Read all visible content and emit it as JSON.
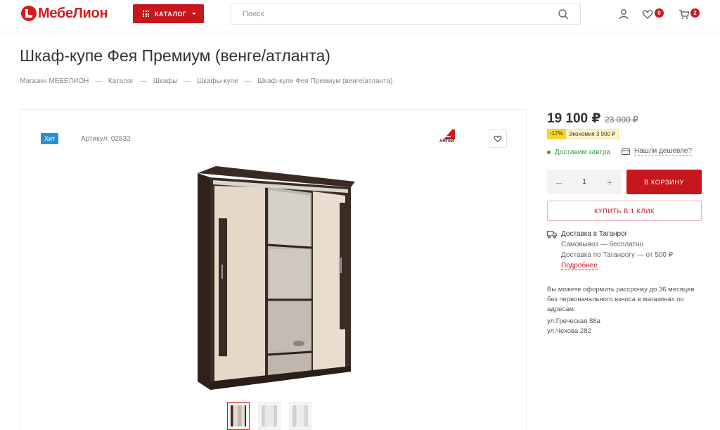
{
  "header": {
    "logo_text": "МебеЛион",
    "catalog_label": "КАТАЛОГ",
    "search_placeholder": "Поиск",
    "favorites_count": "0",
    "cart_count": "2",
    "accent_color": "#c8161d"
  },
  "page": {
    "title": "Шкаф-купе Фея Премиум (венге/атланта)",
    "breadcrumbs": [
      "Магазин МЕБЕЛИОН",
      "Каталог",
      "Шкафы",
      "Шкафы-купе",
      "Шкаф-купе Фея Премиум (венге/атланта)"
    ],
    "breadcrumb_separator": "—"
  },
  "product": {
    "badge": "Хит",
    "sku_label": "Артикул: 02832",
    "brand": "АНТЕЙ",
    "thumbnails_count": 3
  },
  "buybox": {
    "price": "19 100 ₽",
    "old_price": "23 000 ₽",
    "discount_pct": "-17%",
    "savings": "Экономия 3 900 ₽",
    "delivery_tomorrow": "Доставим завтра",
    "cheaper": "Нашли дешевле?",
    "quantity": "1",
    "minus": "–",
    "plus": "+",
    "cart_button": "В КОРЗИНУ",
    "oneclick_button": "КУПИТЬ В 1 КЛИК",
    "delivery_title": "Доставка в Таганрог",
    "pickup": "Самовывоз — бесплатно",
    "delivery_city": "Доставка по Таганрогу — от 500 ₽",
    "more_link": "Подробнее",
    "credit_text": "Вы можете оформить рассрочку до 36 месяцев без первоначального взноса в магазинах по адресам:",
    "addresses": [
      "ул.Греческая 88а",
      "ул.Чехова 282"
    ]
  }
}
